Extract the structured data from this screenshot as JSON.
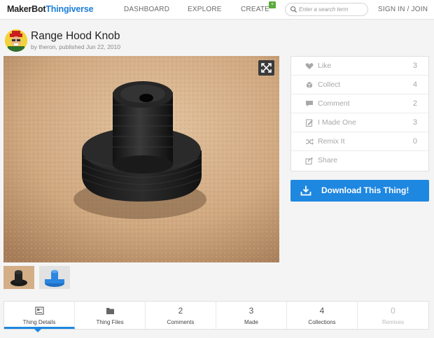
{
  "nav": {
    "logo_part1": "MakerBot",
    "logo_part2": "Thingiverse",
    "dashboard": "DASHBOARD",
    "explore": "EXPLORE",
    "create": "CREATE",
    "create_badge": "+",
    "search_placeholder": "Enter a search term",
    "signin": "SIGN IN / JOIN"
  },
  "thing": {
    "title": "Range Hood Knob",
    "by": "by",
    "author": "theron",
    "published": ", published Jun 22, 2010"
  },
  "actions": [
    {
      "label": "Like",
      "count": "3",
      "icon": "heart-icon"
    },
    {
      "label": "Collect",
      "count": "4",
      "icon": "collect-icon"
    },
    {
      "label": "Comment",
      "count": "2",
      "icon": "comment-icon"
    },
    {
      "label": "I Made One",
      "count": "3",
      "icon": "made-one-icon"
    },
    {
      "label": "Remix It",
      "count": "0",
      "icon": "remix-icon"
    },
    {
      "label": "Share",
      "count": "",
      "icon": "share-icon"
    }
  ],
  "download_label": "Download This Thing!",
  "tabs": [
    {
      "label": "Thing Details",
      "count": "",
      "icon": "details-icon"
    },
    {
      "label": "Thing Files",
      "count": "",
      "icon": "folder-icon"
    },
    {
      "label": "Comments",
      "count": "2"
    },
    {
      "label": "Made",
      "count": "3"
    },
    {
      "label": "Collections",
      "count": "4"
    },
    {
      "label": "Remixes",
      "count": "0"
    }
  ],
  "colors": {
    "accent": "#1e87e0",
    "create_badge": "#5aab3c"
  }
}
